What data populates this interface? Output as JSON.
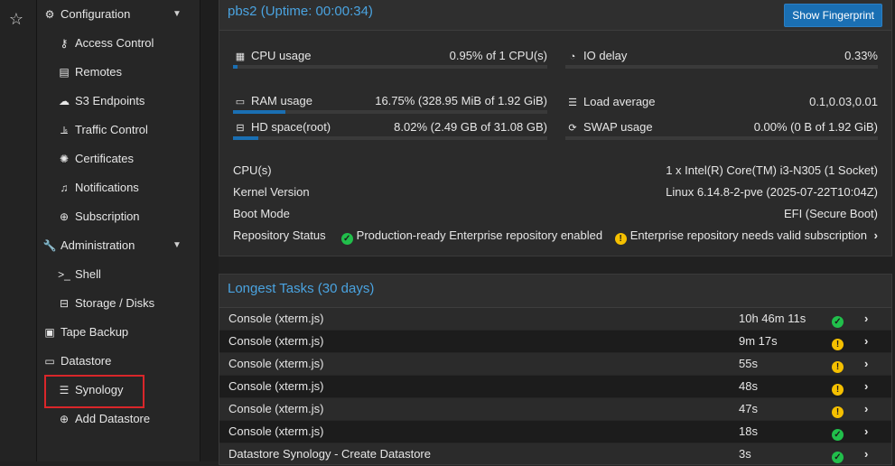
{
  "sidebar": {
    "items": [
      {
        "label": "Configuration",
        "icon": "gears-icon",
        "level": 0,
        "expandable": true
      },
      {
        "label": "Access Control",
        "icon": "key-icon",
        "level": 1
      },
      {
        "label": "Remotes",
        "icon": "server-icon",
        "level": 1
      },
      {
        "label": "S3 Endpoints",
        "icon": "cloud-upload-icon",
        "level": 1
      },
      {
        "label": "Traffic Control",
        "icon": "traffic-icon",
        "level": 1
      },
      {
        "label": "Certificates",
        "icon": "certificate-icon",
        "level": 1
      },
      {
        "label": "Notifications",
        "icon": "bell-icon",
        "level": 1
      },
      {
        "label": "Subscription",
        "icon": "support-icon",
        "level": 1
      },
      {
        "label": "Administration",
        "icon": "wrench-icon",
        "level": 0,
        "expandable": true
      },
      {
        "label": "Shell",
        "icon": "terminal-icon",
        "level": 1
      },
      {
        "label": "Storage / Disks",
        "icon": "hdd-icon",
        "level": 1
      },
      {
        "label": "Tape Backup",
        "icon": "tape-icon",
        "level": 0
      },
      {
        "label": "Datastore",
        "icon": "archive-icon",
        "level": 0
      },
      {
        "label": "Synology",
        "icon": "database-icon",
        "level": 1,
        "selected": true
      },
      {
        "label": "Add Datastore",
        "icon": "plus-circle-icon",
        "level": 1
      }
    ]
  },
  "status_panel": {
    "title": "pbs2 (Uptime: 00:00:34)",
    "fingerprint_button": "Show Fingerprint",
    "cpu": {
      "label": "CPU usage",
      "value": "0.95% of 1 CPU(s)",
      "fraction": 0.0095
    },
    "io_delay": {
      "label": "IO delay",
      "value": "0.33%"
    },
    "ram": {
      "label": "RAM usage",
      "value": "16.75% (328.95 MiB of 1.92 GiB)",
      "fraction": 0.1675
    },
    "load": {
      "label": "Load average",
      "value": "0.1,0.03,0.01"
    },
    "hd": {
      "label": "HD space(root)",
      "value": "8.02% (2.49 GB of 31.08 GB)",
      "fraction": 0.0802
    },
    "swap": {
      "label": "SWAP usage",
      "value": "0.00% (0 B of 1.92 GiB)"
    },
    "info": {
      "cpus_label": "CPU(s)",
      "cpus_value": "1 x Intel(R) Core(TM) i3-N305 (1 Socket)",
      "kernel_label": "Kernel Version",
      "kernel_value": "Linux 6.14.8-2-pve (2025-07-22T10:04Z)",
      "boot_label": "Boot Mode",
      "boot_value": "EFI (Secure Boot)",
      "repo_label": "Repository Status",
      "repo_ok": "Production-ready Enterprise repository enabled",
      "repo_warn": "Enterprise repository needs valid subscription"
    }
  },
  "tasks_panel": {
    "title": "Longest Tasks (30 days)",
    "rows": [
      {
        "name": "Console (xterm.js)",
        "duration": "10h 46m 11s",
        "status": "ok"
      },
      {
        "name": "Console (xterm.js)",
        "duration": "9m 17s",
        "status": "warning"
      },
      {
        "name": "Console (xterm.js)",
        "duration": "55s",
        "status": "warning"
      },
      {
        "name": "Console (xterm.js)",
        "duration": "48s",
        "status": "warning"
      },
      {
        "name": "Console (xterm.js)",
        "duration": "47s",
        "status": "warning"
      },
      {
        "name": "Console (xterm.js)",
        "duration": "18s",
        "status": "ok"
      },
      {
        "name": "Datastore Synology - Create Datastore",
        "duration": "3s",
        "status": "ok"
      }
    ]
  },
  "colors": {
    "accent": "#1a6fb3",
    "title": "#4aa3e0",
    "ok": "#21bf4b",
    "warning": "#f5c000",
    "highlight": "#d9262a"
  }
}
